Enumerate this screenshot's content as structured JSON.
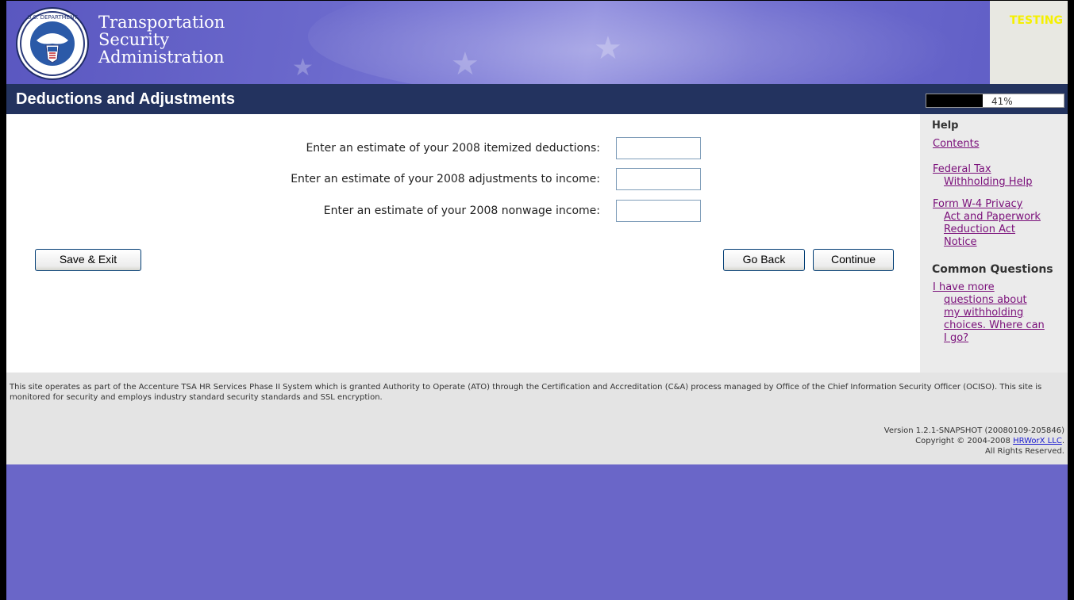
{
  "header": {
    "brand_line1": "Transportation",
    "brand_line2": "Security",
    "brand_line3": "Administration",
    "env_badge": "TESTING",
    "logo_icon": "dhs-seal-icon"
  },
  "page": {
    "title": "Deductions and Adjustments",
    "progress_label": "41%",
    "progress_value": 0.41
  },
  "form": {
    "fields": [
      {
        "label": "Enter an estimate of your 2008 itemized deductions:",
        "value": ""
      },
      {
        "label": "Enter an estimate of your 2008 adjustments to income:",
        "value": ""
      },
      {
        "label": "Enter an estimate of your 2008 nonwage income:",
        "value": ""
      }
    ],
    "save_exit_label": "Save & Exit",
    "go_back_label": "Go Back",
    "continue_label": "Continue"
  },
  "sidebar": {
    "help_heading": "Help",
    "contents_link": "Contents",
    "fed_tax_line1": "Federal Tax",
    "fed_tax_line2": "Withholding Help",
    "w4_line1": "Form W-4 Privacy",
    "w4_line2": "Act and Paperwork",
    "w4_line3": "Reduction Act",
    "w4_line4": "Notice",
    "common_heading": "Common Questions",
    "q_line1": "I have more",
    "q_line2": "questions about",
    "q_line3": "my withholding",
    "q_line4": "choices. Where can",
    "q_line5": "I go?"
  },
  "footer": {
    "notice": "This site operates as part of the Accenture TSA HR Services Phase II System which is granted Authority to Operate (ATO) through the Certification and Accreditation (C&A) process managed by Office of the Chief Information Security Officer (OCISO). This site is monitored for security and employs industry standard security standards and SSL encryption.",
    "version": "Version 1.2.1-SNAPSHOT (20080109-205846)",
    "copyright_prefix": "Copyright © 2004-2008 ",
    "copyright_link": "HRWorX LLC",
    "copyright_suffix": ".",
    "rights": "All Rights Reserved."
  },
  "colors": {
    "header_bg": "#6a66c8",
    "title_bar": "#23335f",
    "testing_text": "#f5f000",
    "link": "#7a0f7a"
  }
}
